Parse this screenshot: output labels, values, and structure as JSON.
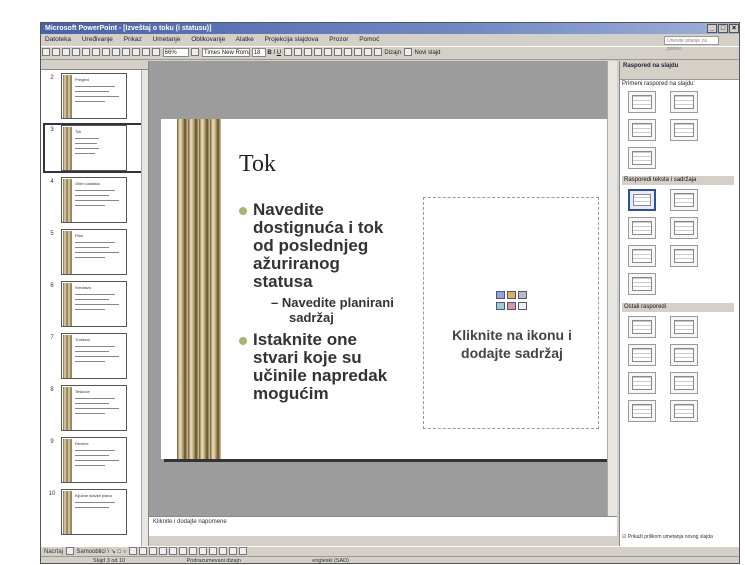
{
  "window": {
    "title": "Microsoft PowerPoint - [Izveštaj o toku (i statusu)]"
  },
  "menubar": {
    "items": [
      "Datoteka",
      "Uređivanje",
      "Prikaz",
      "Umetanje",
      "Oblikovanje",
      "Alatke",
      "Projekcija slajdova",
      "Prozor",
      "Pomoć"
    ],
    "help_placeholder": "Unesite pitanje za pomoć"
  },
  "toolbar": {
    "zoom": "66%",
    "font": "Times New Roman",
    "size": "18",
    "design_label": "Dizajn",
    "new_slide_label": "Novi slajd"
  },
  "thumbnails": [
    {
      "num": "2",
      "title": "Pregled"
    },
    {
      "num": "3",
      "title": "Tok"
    },
    {
      "num": "4",
      "title": "Obim zadatka"
    },
    {
      "num": "5",
      "title": "Plan"
    },
    {
      "num": "6",
      "title": "Sredstva"
    },
    {
      "num": "7",
      "title": "Troškovi"
    },
    {
      "num": "8",
      "title": "Teškoće"
    },
    {
      "num": "9",
      "title": "Rezime"
    },
    {
      "num": "10",
      "title": "Ključne stavke plana"
    }
  ],
  "slide": {
    "title": "Tok",
    "bullet1_lines": [
      "Navedite",
      "dostignuća i tok",
      "od poslednjeg",
      "ažuriranog",
      "statusa"
    ],
    "sub_bullet_lines": [
      "– Navedite planirani",
      "sadržaj"
    ],
    "bullet2_lines": [
      "Istaknite one",
      "stvari koje su",
      "učinile napredak",
      "mogućim"
    ],
    "placeholder_text_lines": [
      "Kliknite na ikonu i",
      "dodajte sadržaj"
    ]
  },
  "notes": {
    "placeholder": "Kliknite i dodajte napomene"
  },
  "taskpane": {
    "title": "Raspored na slajdu",
    "apply_label": "Primeni raspored na slajdu:",
    "section_text_content": "Rasporedi teksta i sadržaja",
    "section_other": "Ostali rasporedi",
    "show_checkbox_label": "Prikaži prilikom umetanja novog slajda"
  },
  "drawbar": {
    "draw_label": "Nacrtaj",
    "autoshapes_label": "Samooblici"
  },
  "statusbar": {
    "slide_pos": "Slajd 3 od 10",
    "design": "Podrazumevani dizajn",
    "lang": "engleski (SAD)"
  }
}
